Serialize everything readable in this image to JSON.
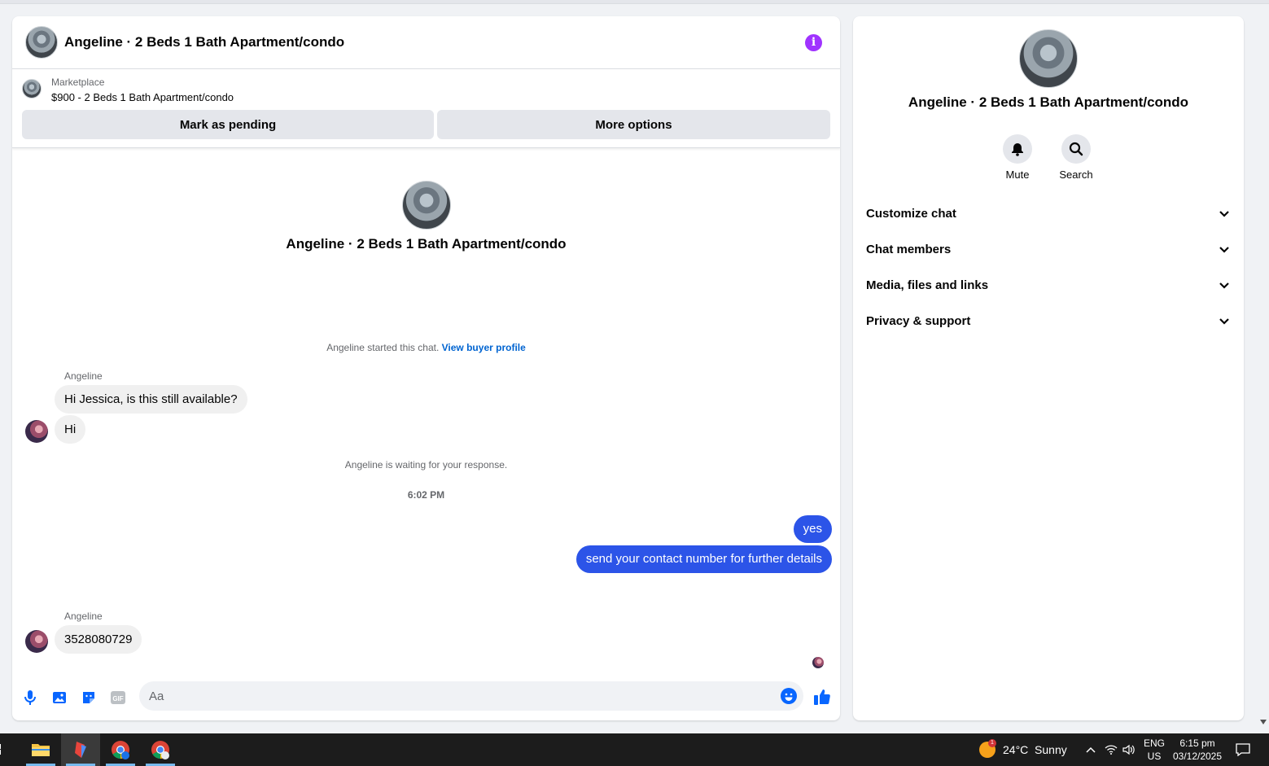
{
  "header": {
    "title": "Angeline · 2 Beds 1 Bath Apartment/condo"
  },
  "listing": {
    "label": "Marketplace",
    "price_title": "$900 - 2 Beds 1 Bath Apartment/condo",
    "mark_pending_label": "Mark as pending",
    "more_options_label": "More options"
  },
  "conversation": {
    "intro_title": "Angeline · 2 Beds 1 Bath Apartment/condo",
    "started_text": "Angeline started this chat.",
    "view_buyer_profile": "View buyer profile",
    "messages": [
      {
        "sender": "Angeline",
        "text": "Hi Jessica, is this still available?"
      },
      {
        "text": "Hi"
      }
    ],
    "waiting_text": "Angeline is waiting for your response.",
    "timestamp": "6:02 PM",
    "outgoing": [
      {
        "text": "yes"
      },
      {
        "text": "send your contact number for further details"
      }
    ],
    "reply": {
      "sender": "Angeline",
      "text": "3528080729"
    }
  },
  "composer": {
    "placeholder": "Aa",
    "icons": [
      "microphone-icon",
      "photo-icon",
      "sticker-icon",
      "gif-icon",
      "emoji-icon",
      "thumbs-up-icon"
    ],
    "gif_label": "GIF"
  },
  "sidebar": {
    "title": "Angeline · 2 Beds 1 Bath Apartment/condo",
    "actions": [
      {
        "label": "Mute",
        "icon": "bell-icon"
      },
      {
        "label": "Search",
        "icon": "search-icon"
      }
    ],
    "sections": [
      {
        "label": "Customize chat"
      },
      {
        "label": "Chat members"
      },
      {
        "label": "Media, files and links"
      },
      {
        "label": "Privacy & support"
      }
    ]
  },
  "taskbar": {
    "weather": "24°C  Sunny",
    "weather_badge": "1",
    "language": "ENG",
    "region": "US",
    "time": "6:15 pm",
    "date": "03/12/2025"
  },
  "colors": {
    "accent_blue": "#0866ff",
    "outgoing_bubble": "#2c54e8",
    "info_purple": "#a033ff"
  }
}
